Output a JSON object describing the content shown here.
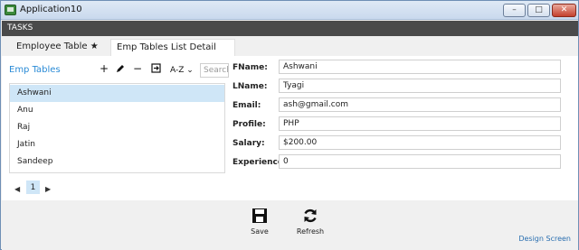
{
  "window": {
    "title": "Application10",
    "minimize": "–",
    "maximize": "□",
    "close": "✕"
  },
  "tasks": {
    "label": "TASKS"
  },
  "tabs": [
    {
      "label": "Employee Table ★"
    },
    {
      "label": "Emp Tables List Detail"
    }
  ],
  "list": {
    "header": "Emp Tables",
    "sort_label": "A-Z ⌄",
    "search_placeholder": "Search",
    "items": [
      {
        "label": "Ashwani"
      },
      {
        "label": "Anu"
      },
      {
        "label": "Raj"
      },
      {
        "label": "Jatin"
      },
      {
        "label": "Sandeep"
      }
    ],
    "pager": {
      "current_page": "1"
    }
  },
  "detail": {
    "fields": [
      {
        "label": "FName:",
        "value": "Ashwani"
      },
      {
        "label": "LName:",
        "value": "Tyagi"
      },
      {
        "label": "Email:",
        "value": "ash@gmail.com"
      },
      {
        "label": "Profile:",
        "value": "PHP"
      },
      {
        "label": "Salary:",
        "value": "$200.00"
      },
      {
        "label": "Experience:",
        "value": "0"
      }
    ]
  },
  "actions": {
    "save_label": "Save",
    "refresh_label": "Refresh",
    "design_screen_label": "Design Screen"
  },
  "colors": {
    "accent": "#2a8bd6",
    "selection": "#cfe6f7",
    "tasks_bar": "#4a4a4a"
  }
}
